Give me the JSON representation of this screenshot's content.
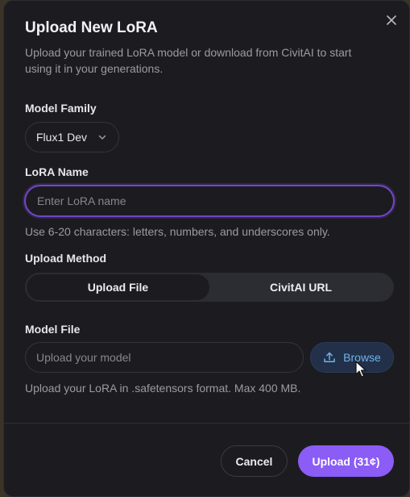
{
  "dialog": {
    "title": "Upload New LoRA",
    "subtitle": "Upload your trained LoRA model or download from CivitAI to start using it in your generations."
  },
  "model_family": {
    "label": "Model Family",
    "selected": "Flux1 Dev"
  },
  "lora_name": {
    "label": "LoRA Name",
    "value": "",
    "placeholder": "Enter LoRA name",
    "hint": "Use 6-20 characters: letters, numbers, and underscores only."
  },
  "upload_method": {
    "label": "Upload Method",
    "options": [
      "Upload File",
      "CivitAI URL"
    ],
    "selected": "Upload File"
  },
  "model_file": {
    "label": "Model File",
    "placeholder": "Upload your model",
    "browse_label": "Browse",
    "hint": "Upload your LoRA in .safetensors format. Max 400 MB."
  },
  "footer": {
    "cancel_label": "Cancel",
    "upload_label": "Upload (31¢)"
  },
  "colors": {
    "accent": "#8b5cf6",
    "focus_ring": "#7047c9",
    "browse_text": "#6fb3ec",
    "modal_bg": "#1c1c20"
  },
  "icons": {
    "close": "close-icon",
    "chevron": "chevron-down-icon",
    "upload": "upload-icon",
    "cursor": "mouse-cursor"
  }
}
